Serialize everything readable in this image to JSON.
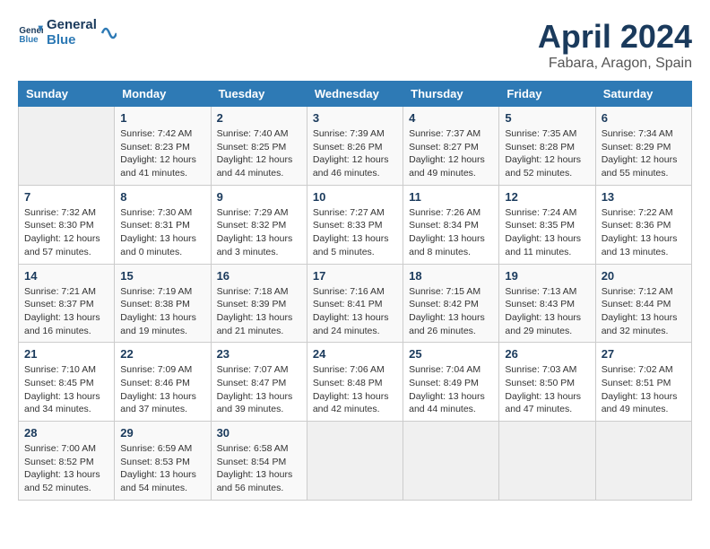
{
  "logo": {
    "text_general": "General",
    "text_blue": "Blue"
  },
  "title": "April 2024",
  "location": "Fabara, Aragon, Spain",
  "days_of_week": [
    "Sunday",
    "Monday",
    "Tuesday",
    "Wednesday",
    "Thursday",
    "Friday",
    "Saturday"
  ],
  "weeks": [
    [
      {
        "day": "",
        "sunrise": "",
        "sunset": "",
        "daylight": ""
      },
      {
        "day": "1",
        "sunrise": "Sunrise: 7:42 AM",
        "sunset": "Sunset: 8:23 PM",
        "daylight": "Daylight: 12 hours and 41 minutes."
      },
      {
        "day": "2",
        "sunrise": "Sunrise: 7:40 AM",
        "sunset": "Sunset: 8:25 PM",
        "daylight": "Daylight: 12 hours and 44 minutes."
      },
      {
        "day": "3",
        "sunrise": "Sunrise: 7:39 AM",
        "sunset": "Sunset: 8:26 PM",
        "daylight": "Daylight: 12 hours and 46 minutes."
      },
      {
        "day": "4",
        "sunrise": "Sunrise: 7:37 AM",
        "sunset": "Sunset: 8:27 PM",
        "daylight": "Daylight: 12 hours and 49 minutes."
      },
      {
        "day": "5",
        "sunrise": "Sunrise: 7:35 AM",
        "sunset": "Sunset: 8:28 PM",
        "daylight": "Daylight: 12 hours and 52 minutes."
      },
      {
        "day": "6",
        "sunrise": "Sunrise: 7:34 AM",
        "sunset": "Sunset: 8:29 PM",
        "daylight": "Daylight: 12 hours and 55 minutes."
      }
    ],
    [
      {
        "day": "7",
        "sunrise": "Sunrise: 7:32 AM",
        "sunset": "Sunset: 8:30 PM",
        "daylight": "Daylight: 12 hours and 57 minutes."
      },
      {
        "day": "8",
        "sunrise": "Sunrise: 7:30 AM",
        "sunset": "Sunset: 8:31 PM",
        "daylight": "Daylight: 13 hours and 0 minutes."
      },
      {
        "day": "9",
        "sunrise": "Sunrise: 7:29 AM",
        "sunset": "Sunset: 8:32 PM",
        "daylight": "Daylight: 13 hours and 3 minutes."
      },
      {
        "day": "10",
        "sunrise": "Sunrise: 7:27 AM",
        "sunset": "Sunset: 8:33 PM",
        "daylight": "Daylight: 13 hours and 5 minutes."
      },
      {
        "day": "11",
        "sunrise": "Sunrise: 7:26 AM",
        "sunset": "Sunset: 8:34 PM",
        "daylight": "Daylight: 13 hours and 8 minutes."
      },
      {
        "day": "12",
        "sunrise": "Sunrise: 7:24 AM",
        "sunset": "Sunset: 8:35 PM",
        "daylight": "Daylight: 13 hours and 11 minutes."
      },
      {
        "day": "13",
        "sunrise": "Sunrise: 7:22 AM",
        "sunset": "Sunset: 8:36 PM",
        "daylight": "Daylight: 13 hours and 13 minutes."
      }
    ],
    [
      {
        "day": "14",
        "sunrise": "Sunrise: 7:21 AM",
        "sunset": "Sunset: 8:37 PM",
        "daylight": "Daylight: 13 hours and 16 minutes."
      },
      {
        "day": "15",
        "sunrise": "Sunrise: 7:19 AM",
        "sunset": "Sunset: 8:38 PM",
        "daylight": "Daylight: 13 hours and 19 minutes."
      },
      {
        "day": "16",
        "sunrise": "Sunrise: 7:18 AM",
        "sunset": "Sunset: 8:39 PM",
        "daylight": "Daylight: 13 hours and 21 minutes."
      },
      {
        "day": "17",
        "sunrise": "Sunrise: 7:16 AM",
        "sunset": "Sunset: 8:41 PM",
        "daylight": "Daylight: 13 hours and 24 minutes."
      },
      {
        "day": "18",
        "sunrise": "Sunrise: 7:15 AM",
        "sunset": "Sunset: 8:42 PM",
        "daylight": "Daylight: 13 hours and 26 minutes."
      },
      {
        "day": "19",
        "sunrise": "Sunrise: 7:13 AM",
        "sunset": "Sunset: 8:43 PM",
        "daylight": "Daylight: 13 hours and 29 minutes."
      },
      {
        "day": "20",
        "sunrise": "Sunrise: 7:12 AM",
        "sunset": "Sunset: 8:44 PM",
        "daylight": "Daylight: 13 hours and 32 minutes."
      }
    ],
    [
      {
        "day": "21",
        "sunrise": "Sunrise: 7:10 AM",
        "sunset": "Sunset: 8:45 PM",
        "daylight": "Daylight: 13 hours and 34 minutes."
      },
      {
        "day": "22",
        "sunrise": "Sunrise: 7:09 AM",
        "sunset": "Sunset: 8:46 PM",
        "daylight": "Daylight: 13 hours and 37 minutes."
      },
      {
        "day": "23",
        "sunrise": "Sunrise: 7:07 AM",
        "sunset": "Sunset: 8:47 PM",
        "daylight": "Daylight: 13 hours and 39 minutes."
      },
      {
        "day": "24",
        "sunrise": "Sunrise: 7:06 AM",
        "sunset": "Sunset: 8:48 PM",
        "daylight": "Daylight: 13 hours and 42 minutes."
      },
      {
        "day": "25",
        "sunrise": "Sunrise: 7:04 AM",
        "sunset": "Sunset: 8:49 PM",
        "daylight": "Daylight: 13 hours and 44 minutes."
      },
      {
        "day": "26",
        "sunrise": "Sunrise: 7:03 AM",
        "sunset": "Sunset: 8:50 PM",
        "daylight": "Daylight: 13 hours and 47 minutes."
      },
      {
        "day": "27",
        "sunrise": "Sunrise: 7:02 AM",
        "sunset": "Sunset: 8:51 PM",
        "daylight": "Daylight: 13 hours and 49 minutes."
      }
    ],
    [
      {
        "day": "28",
        "sunrise": "Sunrise: 7:00 AM",
        "sunset": "Sunset: 8:52 PM",
        "daylight": "Daylight: 13 hours and 52 minutes."
      },
      {
        "day": "29",
        "sunrise": "Sunrise: 6:59 AM",
        "sunset": "Sunset: 8:53 PM",
        "daylight": "Daylight: 13 hours and 54 minutes."
      },
      {
        "day": "30",
        "sunrise": "Sunrise: 6:58 AM",
        "sunset": "Sunset: 8:54 PM",
        "daylight": "Daylight: 13 hours and 56 minutes."
      },
      {
        "day": "",
        "sunrise": "",
        "sunset": "",
        "daylight": ""
      },
      {
        "day": "",
        "sunrise": "",
        "sunset": "",
        "daylight": ""
      },
      {
        "day": "",
        "sunrise": "",
        "sunset": "",
        "daylight": ""
      },
      {
        "day": "",
        "sunrise": "",
        "sunset": "",
        "daylight": ""
      }
    ]
  ]
}
